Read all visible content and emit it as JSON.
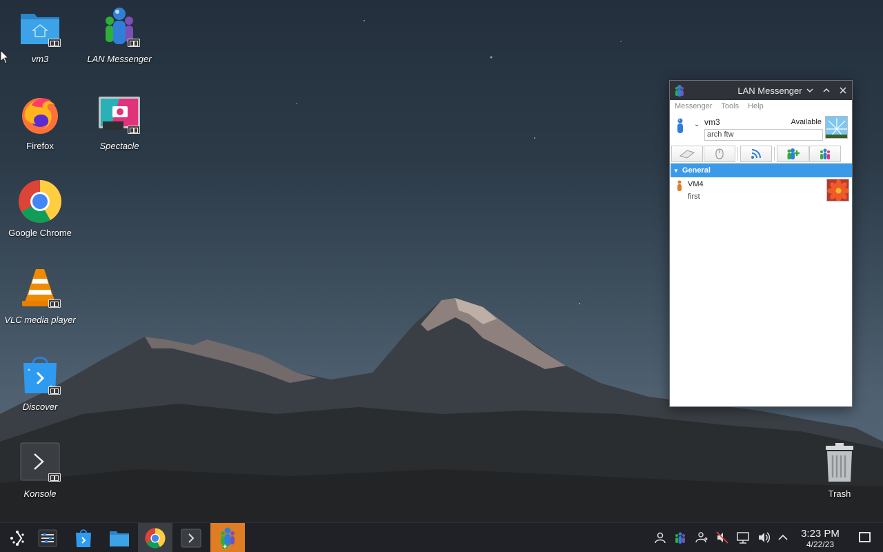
{
  "desktop": {
    "icons": [
      {
        "label": "vm3",
        "italic": true
      },
      {
        "label": "LAN Messenger",
        "italic": true
      },
      {
        "label": "Firefox",
        "italic": false
      },
      {
        "label": "Spectacle",
        "italic": true
      },
      {
        "label": "Google Chrome",
        "italic": false
      },
      {
        "label": "VLC media player",
        "italic": true
      },
      {
        "label": "Discover",
        "italic": true
      },
      {
        "label": "Konsole",
        "italic": true
      },
      {
        "label": "Trash",
        "italic": false
      }
    ]
  },
  "messenger": {
    "title": "LAN Messenger",
    "menu": [
      "Messenger",
      "Tools",
      "Help"
    ],
    "user": {
      "name": "vm3",
      "status": "Available",
      "note": "arch ftw"
    },
    "toolbar_icons": [
      "eraser-icon",
      "mouse-icon",
      "broadcast-icon",
      "add-contact-icon",
      "group-icon"
    ],
    "group": {
      "name": "General",
      "expanded": true
    },
    "contacts": [
      {
        "name": "VM4",
        "note": "first"
      }
    ],
    "colors": {
      "titlebar": "#2f3238",
      "selection": "#3b9ae8"
    }
  },
  "taskbar": {
    "clock": {
      "time": "3:23 PM",
      "date": "4/22/23"
    },
    "pinned": [
      "application-launcher-icon",
      "settings-icon",
      "discover-icon",
      "files-icon",
      "chrome-icon",
      "konsole-icon",
      "lan-messenger-icon"
    ],
    "tray": [
      "user-icon",
      "lan-messenger-tray-icon",
      "user-switch-icon",
      "muted-icon",
      "network-icon",
      "volume-icon",
      "expand-tray-icon"
    ]
  }
}
